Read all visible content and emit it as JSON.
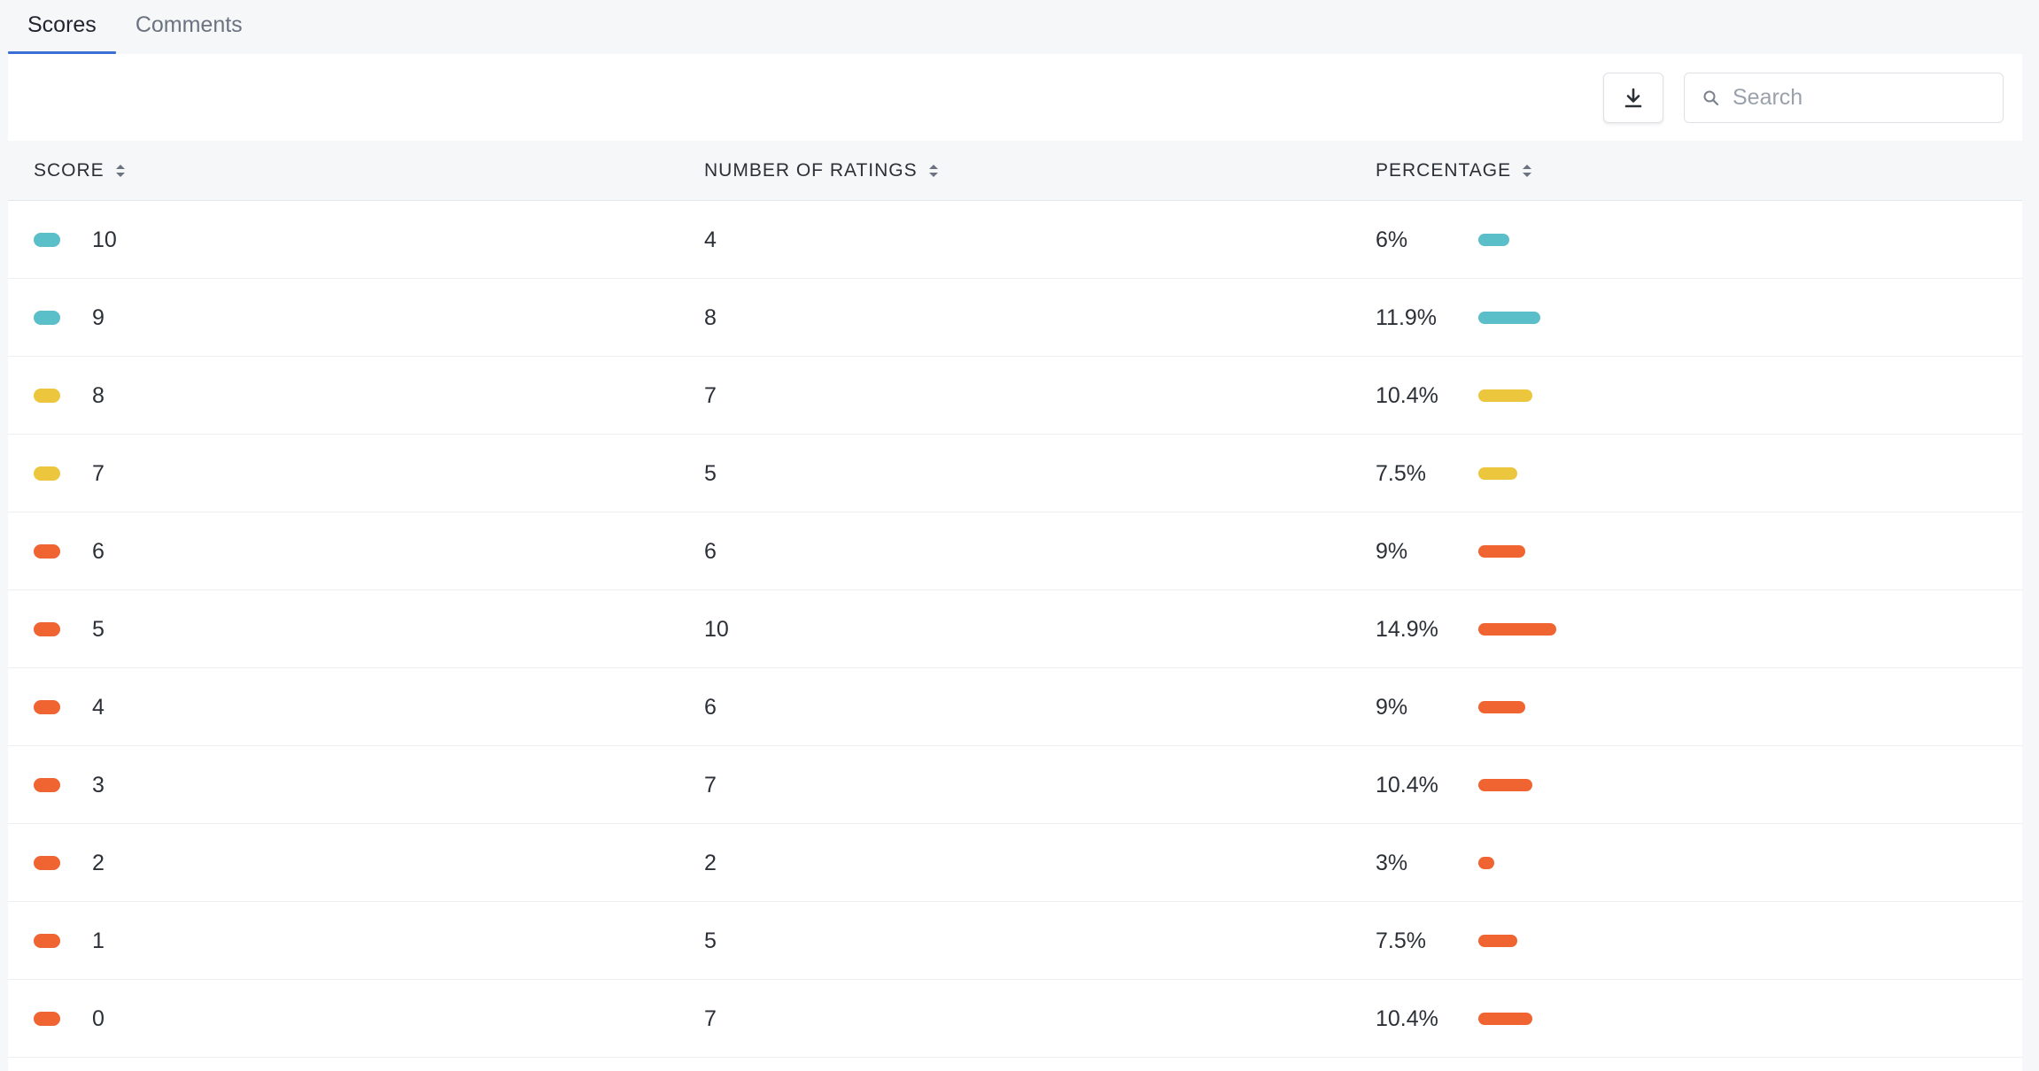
{
  "tabs": [
    {
      "label": "Scores",
      "active": true
    },
    {
      "label": "Comments",
      "active": false
    }
  ],
  "toolbar": {
    "download_icon": "download-icon",
    "search_placeholder": "Search"
  },
  "colors": {
    "promoter": "#5bbfc9",
    "passive": "#ecc73d",
    "detractor": "#ef6431"
  },
  "table": {
    "columns": [
      {
        "key": "score",
        "label": "SCORE"
      },
      {
        "key": "ratings",
        "label": "NUMBER OF RATINGS"
      },
      {
        "key": "percentage",
        "label": "PERCENTAGE"
      }
    ],
    "rows": [
      {
        "score": "10",
        "ratings": "4",
        "percentage": "6%",
        "percent_value": 6.0,
        "category": "promoter"
      },
      {
        "score": "9",
        "ratings": "8",
        "percentage": "11.9%",
        "percent_value": 11.9,
        "category": "promoter"
      },
      {
        "score": "8",
        "ratings": "7",
        "percentage": "10.4%",
        "percent_value": 10.4,
        "category": "passive"
      },
      {
        "score": "7",
        "ratings": "5",
        "percentage": "7.5%",
        "percent_value": 7.5,
        "category": "passive"
      },
      {
        "score": "6",
        "ratings": "6",
        "percentage": "9%",
        "percent_value": 9.0,
        "category": "detractor"
      },
      {
        "score": "5",
        "ratings": "10",
        "percentage": "14.9%",
        "percent_value": 14.9,
        "category": "detractor"
      },
      {
        "score": "4",
        "ratings": "6",
        "percentage": "9%",
        "percent_value": 9.0,
        "category": "detractor"
      },
      {
        "score": "3",
        "ratings": "7",
        "percentage": "10.4%",
        "percent_value": 10.4,
        "category": "detractor"
      },
      {
        "score": "2",
        "ratings": "2",
        "percentage": "3%",
        "percent_value": 3.0,
        "category": "detractor"
      },
      {
        "score": "1",
        "ratings": "5",
        "percentage": "7.5%",
        "percent_value": 7.5,
        "category": "detractor"
      },
      {
        "score": "0",
        "ratings": "7",
        "percentage": "10.4%",
        "percent_value": 10.4,
        "category": "detractor"
      }
    ]
  }
}
